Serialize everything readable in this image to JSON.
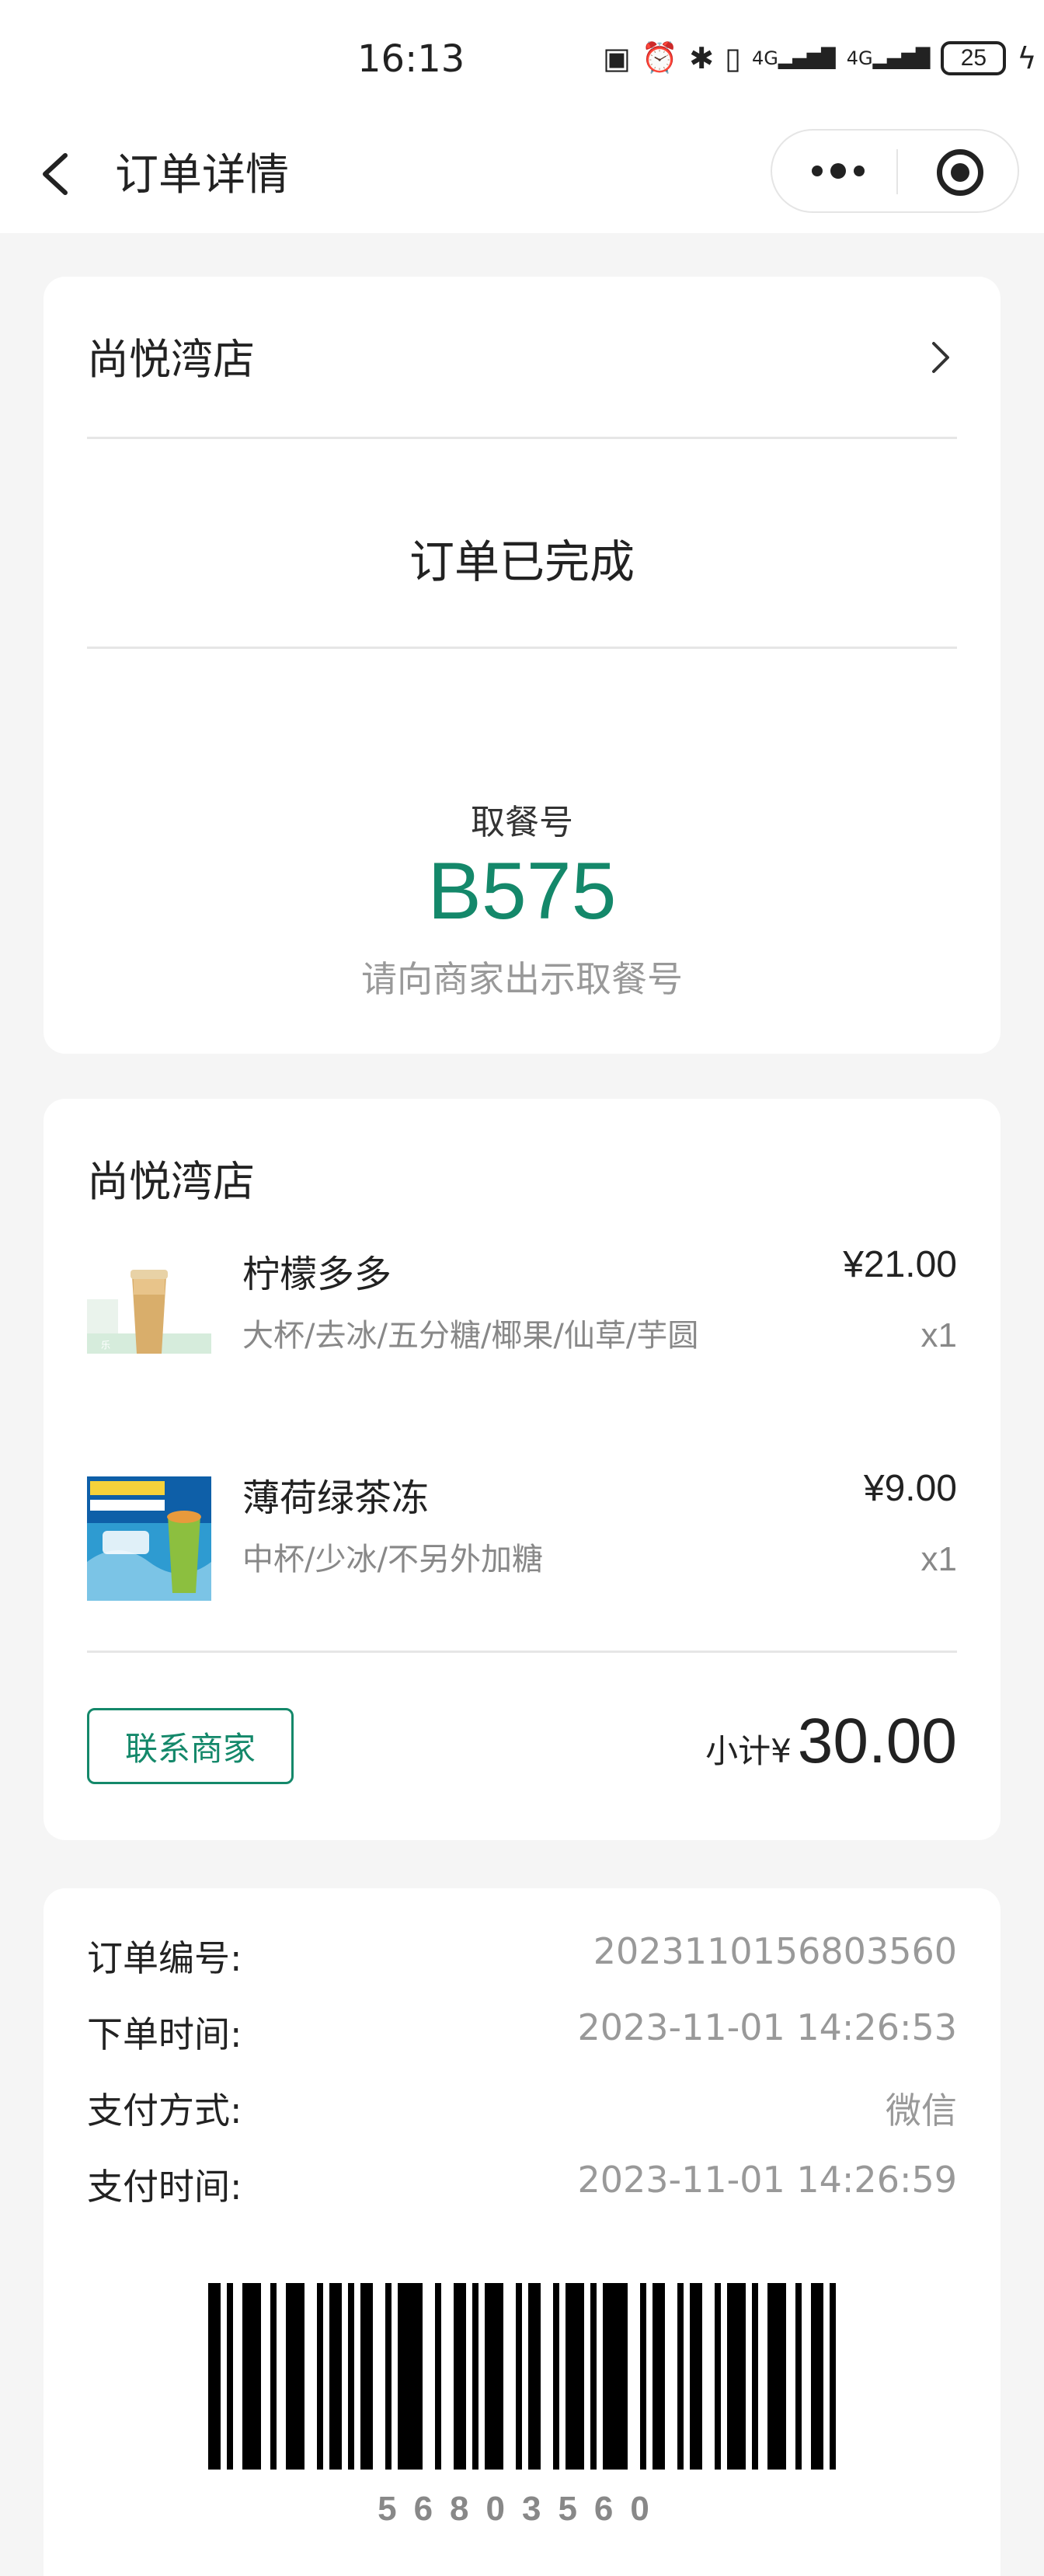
{
  "status_bar": {
    "time": "16:13",
    "network": "4G",
    "battery": "25"
  },
  "nav": {
    "title": "订单详情"
  },
  "order_status": {
    "store_name": "尚悦湾店",
    "status": "订单已完成",
    "pickup_label": "取餐号",
    "pickup_number": "B575",
    "pickup_hint": "请向商家出示取餐号"
  },
  "items_card": {
    "store_name": "尚悦湾店",
    "items": [
      {
        "name": "柠檬多多",
        "price": "¥21.00",
        "spec": "大杯/去冰/五分糖/椰果/仙草/芋圆",
        "qty": "x1"
      },
      {
        "name": "薄荷绿茶冻",
        "price": "¥9.00",
        "spec": "中杯/少冰/不另外加糖",
        "qty": "x1"
      }
    ],
    "contact_label": "联系商家",
    "subtotal_label": "小计¥",
    "subtotal_value": "30.00"
  },
  "order_info": {
    "rows": [
      {
        "label": "订单编号:",
        "value": "2023110156803560"
      },
      {
        "label": "下单时间:",
        "value": "2023-11-01 14:26:53"
      },
      {
        "label": "支付方式:",
        "value": "微信"
      },
      {
        "label": "支付时间:",
        "value": "2023-11-01 14:26:59"
      }
    ],
    "barcode_number": "56803560"
  },
  "colors": {
    "accent": "#14886a",
    "background": "#f5f5f5"
  }
}
